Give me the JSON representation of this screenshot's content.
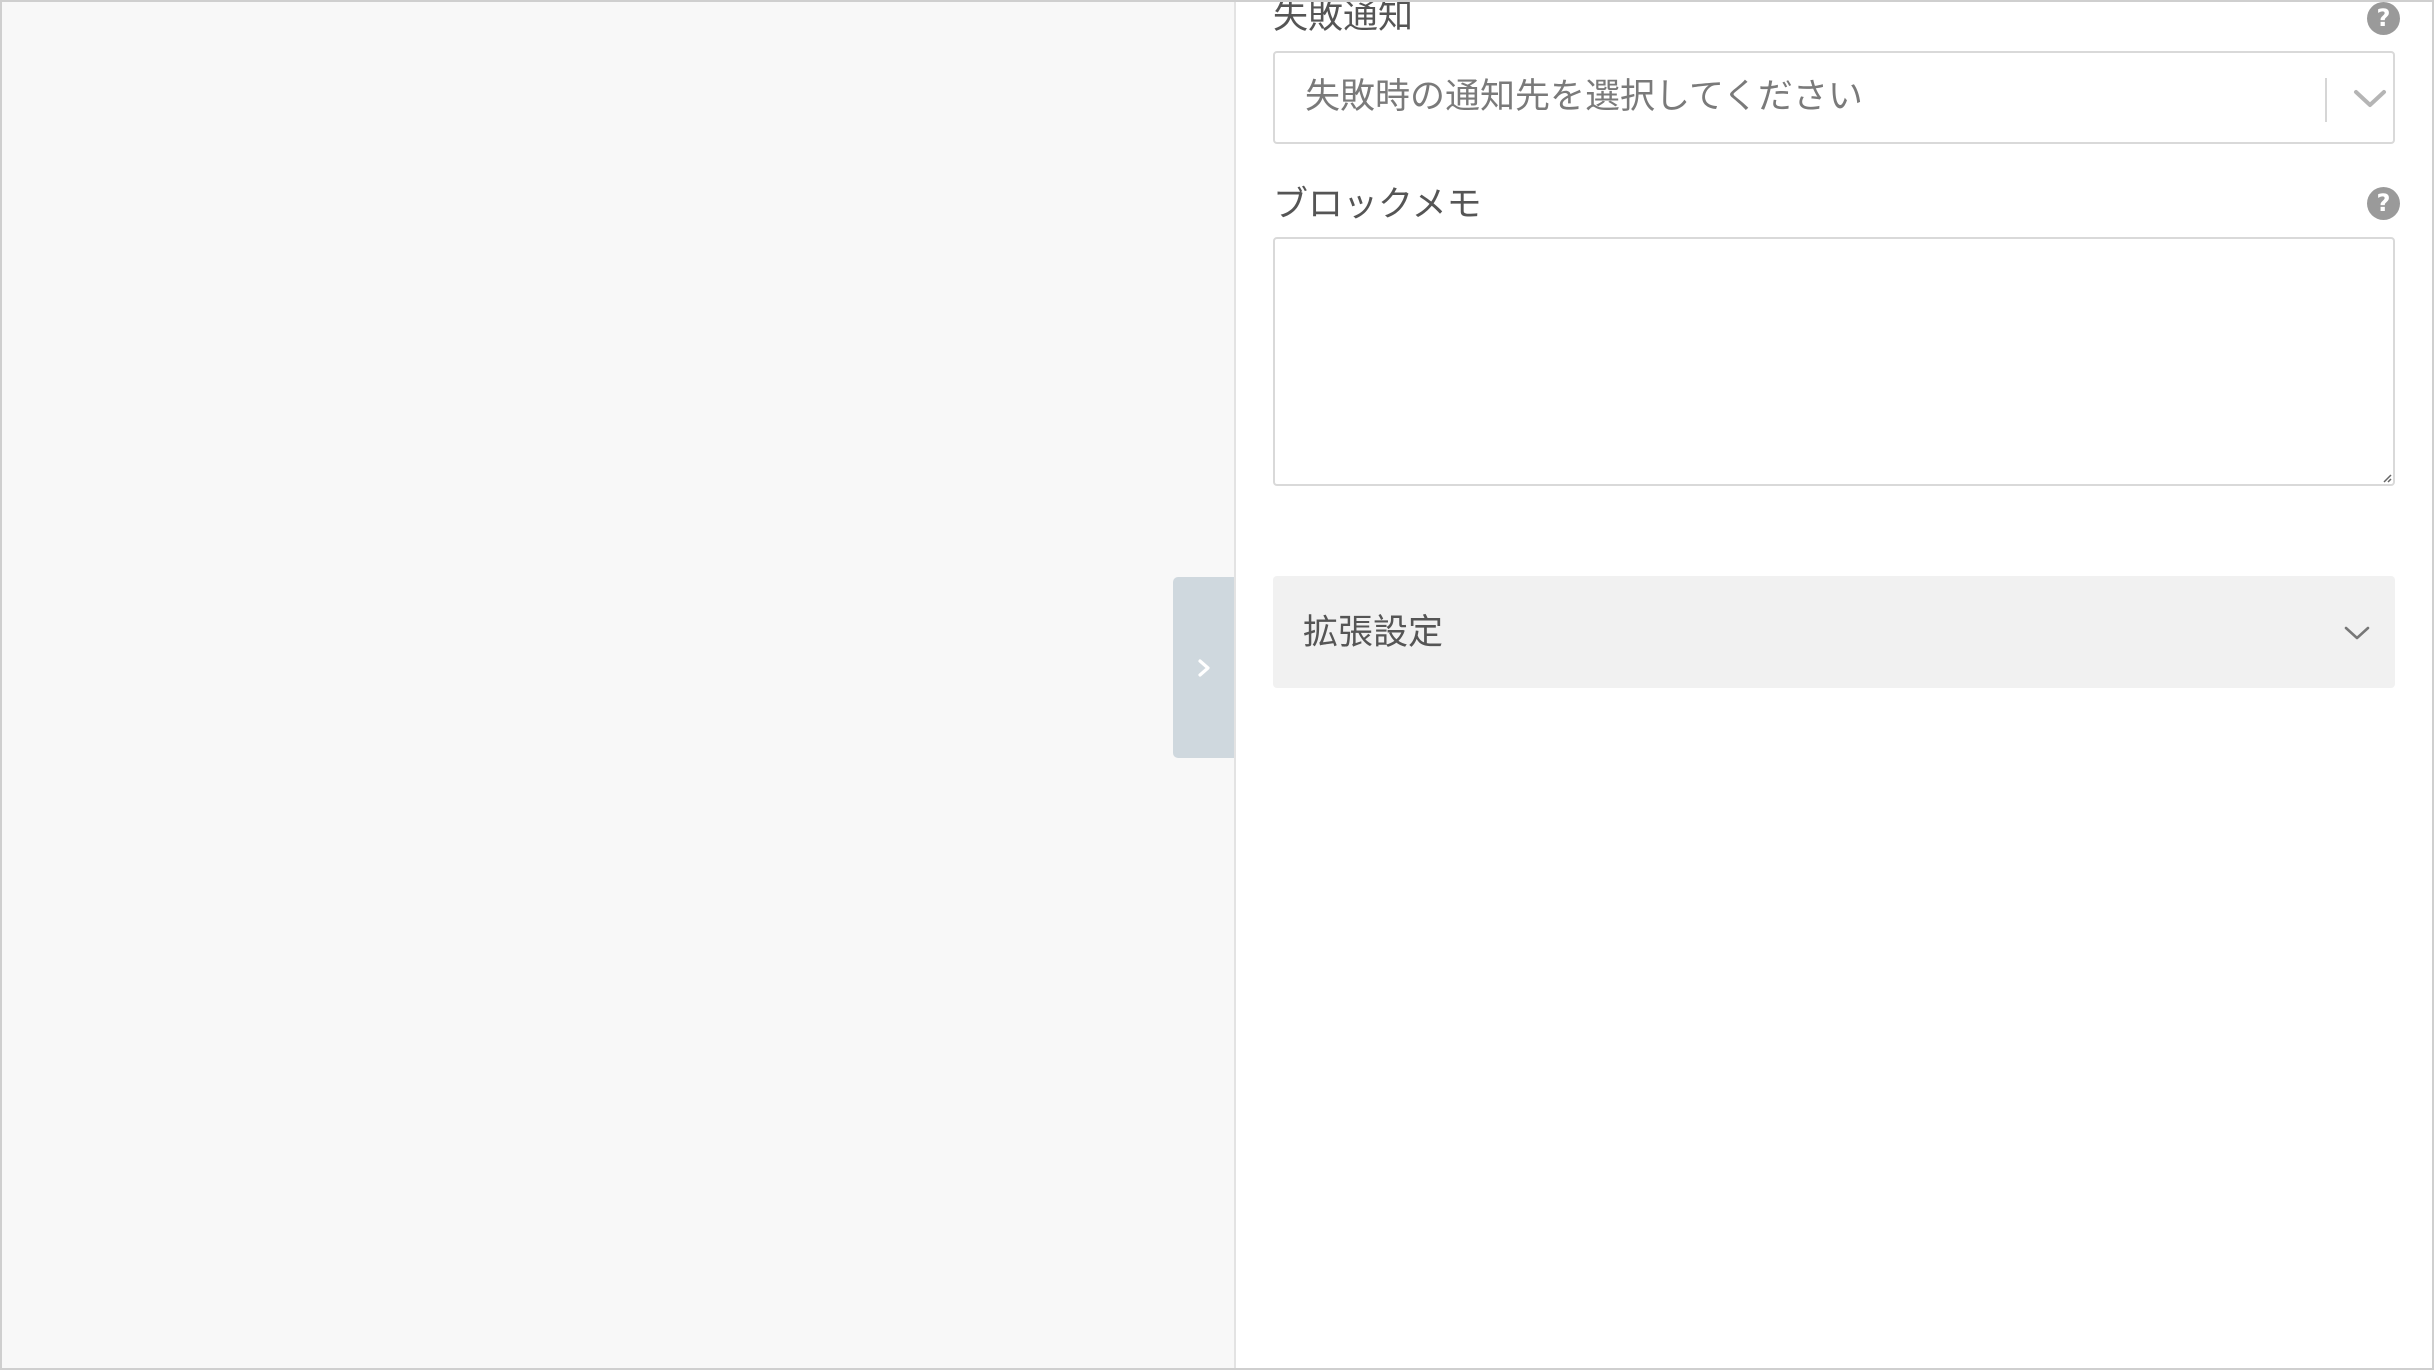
{
  "left_pane": {
    "collapse_handle_icon": "chevron-right-icon"
  },
  "failure_notification": {
    "label": "失敗通知",
    "help_icon": "?",
    "placeholder": "失敗時の通知先を選択してください"
  },
  "block_memo": {
    "label": "ブロックメモ",
    "help_icon": "?",
    "value": ""
  },
  "advanced_settings": {
    "title": "拡張設定",
    "expanded": false
  },
  "colors": {
    "canvas_bg": "#f8f8f8",
    "handle_bg": "#cfd8de",
    "accordion_bg": "#f1f1f1",
    "help_icon_bg": "#9a9a9a",
    "border": "#d9d9d9"
  }
}
